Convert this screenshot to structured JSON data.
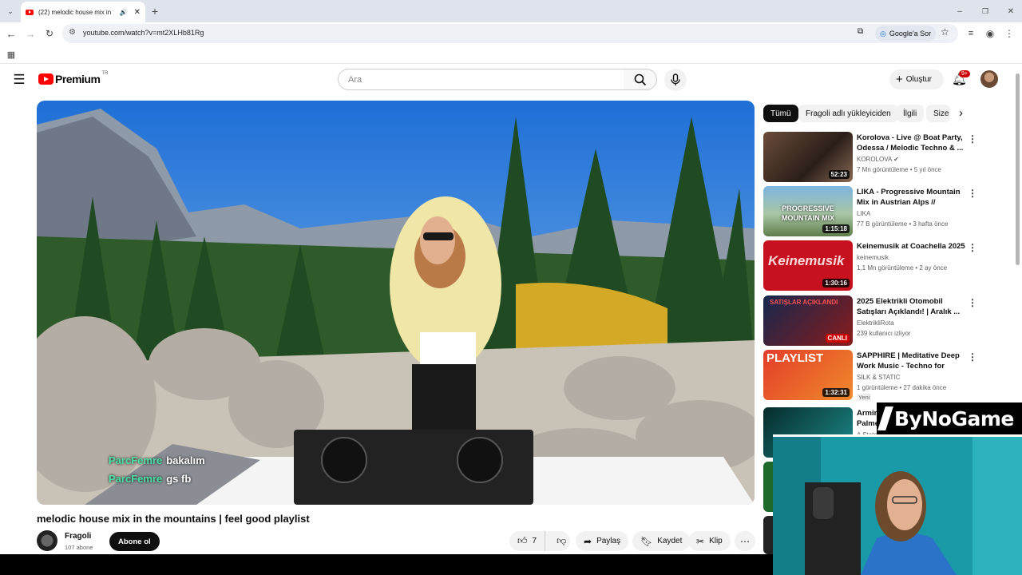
{
  "browser": {
    "tab_title": "(22) melodic house mix in t",
    "url": "youtube.com/watch?v=mt2XLHb81Rg",
    "ask_google": "Google'a Sor"
  },
  "header": {
    "logo_text": "Premium",
    "region": "TR",
    "search_placeholder": "Ara",
    "create_label": "Oluştur",
    "notifications_badge": "9+"
  },
  "video": {
    "title": "melodic house mix in the mountains | feel good playlist",
    "channel": "Fragoli",
    "subscribers": "107 abone",
    "subscribe_label": "Abone ol",
    "likes": "7",
    "share_label": "Paylaş",
    "save_label": "Kaydet",
    "clip_label": "Klip",
    "chat": [
      {
        "user": "ParcFemre",
        "message": "bakalım"
      },
      {
        "user": "ParcFemre",
        "message": "gs fb"
      }
    ]
  },
  "chips": [
    "Tümü",
    "Fragoli adlı yükleyiciden",
    "İlgili",
    "Size"
  ],
  "related": [
    {
      "title": "Korolova - Live @ Boat Party, Odessa / Melodic Techno & ...",
      "channel": "KOROLOVA",
      "meta": "7 Mn görüntüleme • 5 yıl önce",
      "duration": "52:23",
      "thumb_text": ""
    },
    {
      "title": "LIKA - Progressive Mountain Mix in Austrian Alps // Melodic...",
      "channel": "LIKA",
      "meta": "77 B görüntüleme • 3 hafta önce",
      "duration": "1:15:18",
      "thumb_text": "PROGRESSIVE MOUNTAIN MIX"
    },
    {
      "title": "Keinemusik at Coachella 2025",
      "channel": "keinemusik",
      "meta": "1,1 Mn görüntüleme • 2 ay önce",
      "duration": "1:30:16",
      "thumb_text": "Keinemusik"
    },
    {
      "title": "2025 Elektrikli Otomobil Satışları Açıklandı! | Aralık ...",
      "channel": "ElektrikliRota",
      "meta": "239 kullanıcı izliyor",
      "duration": "CANLI",
      "thumb_text": "SATIŞLAR AÇIKLANDI"
    },
    {
      "title": "SAPPHIRE | Meditative Deep Work Music - Techno for Focu...",
      "channel": "SILK & STATIC",
      "meta": "1 görüntüleme • 27 dakika önce",
      "badge": "Yeni",
      "duration": "1:32:31",
      "thumb_text": "PLAYLIST"
    },
    {
      "title": "Armin Palme",
      "channel": "A State",
      "meta": "",
      "duration": "",
      "thumb_text": ""
    }
  ],
  "overlay": {
    "brand": "ByNoGame"
  }
}
